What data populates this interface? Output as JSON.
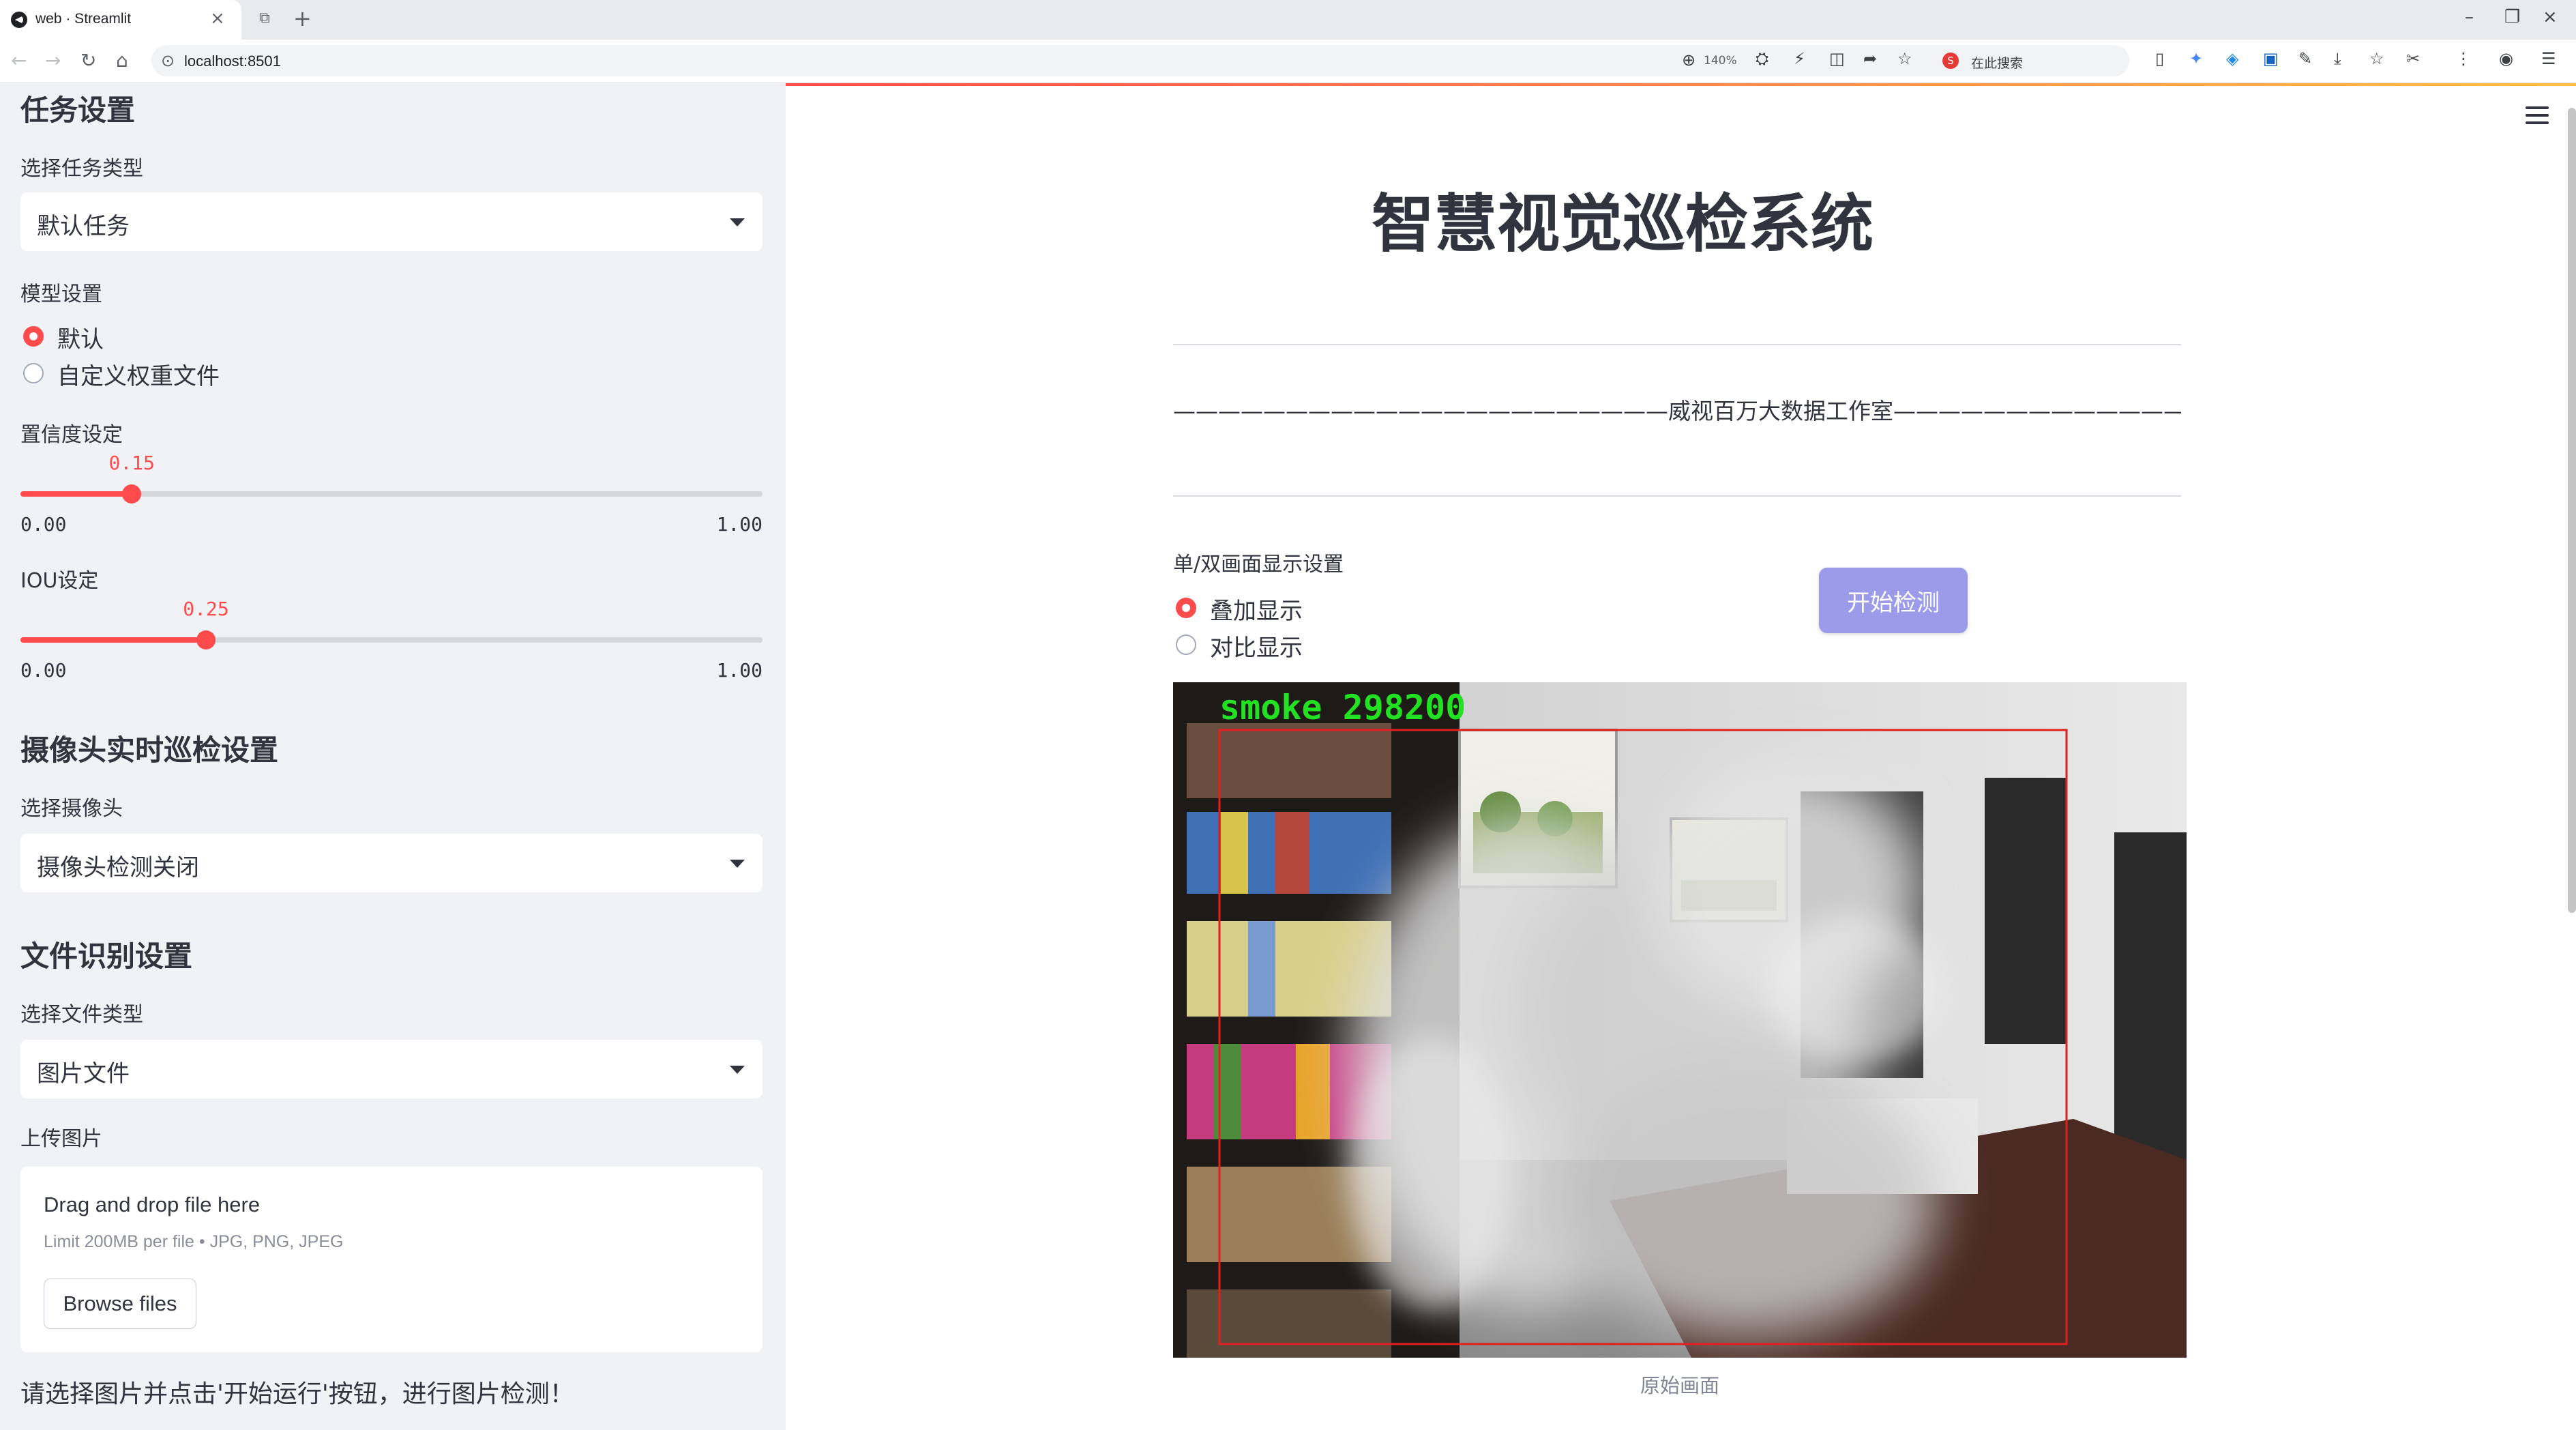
{
  "browser": {
    "tab_title": "web · Streamlit",
    "url": "localhost:8501",
    "zoom": "140%",
    "search_label": "在此搜索",
    "search_engine_mark": "S"
  },
  "sidebar": {
    "task_heading": "任务设置",
    "task_type_label": "选择任务类型",
    "task_type_value": "默认任务",
    "model_label": "模型设置",
    "model_options": [
      "默认",
      "自定义权重文件"
    ],
    "model_selected": "默认",
    "conf_label": "置信度设定",
    "conf": {
      "value": 0.15,
      "value_text": "0.15",
      "min": "0.00",
      "max": "1.00"
    },
    "iou_label": "IOU设定",
    "iou": {
      "value": 0.25,
      "value_text": "0.25",
      "min": "0.00",
      "max": "1.00"
    },
    "camera_heading": "摄像头实时巡检设置",
    "camera_label": "选择摄像头",
    "camera_value": "摄像头检测关闭",
    "file_heading": "文件识别设置",
    "file_type_label": "选择文件类型",
    "file_type_value": "图片文件",
    "upload_label": "上传图片",
    "uploader": {
      "title": "Drag and drop file here",
      "limit": "Limit 200MB per file • JPG, PNG, JPEG",
      "button": "Browse files"
    },
    "hint": "请选择图片并点击'开始运行'按钮，进行图片检测！"
  },
  "main": {
    "title": "智慧视觉巡检系统",
    "studio": "——————————————————————威视百万大数据工作室———————————————————————",
    "display_label": "单/双画面显示设置",
    "display_options": [
      "叠加显示",
      "对比显示"
    ],
    "display_selected": "叠加显示",
    "start_button": "开始检测",
    "detection_label": "smoke 298200",
    "caption": "原始画面"
  },
  "colors": {
    "accent": "#ff4b4b",
    "button": "#9c9be9",
    "sidebar_bg": "#f0f2f6",
    "box": "#e02020",
    "detection_text": "#22e022"
  }
}
